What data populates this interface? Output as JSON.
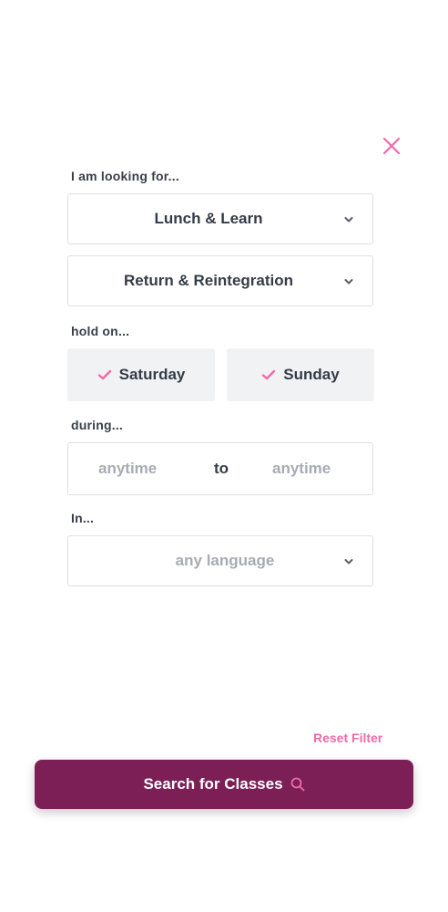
{
  "icons": {
    "close": "close-icon",
    "chevron": "chevron-down-icon",
    "check": "check-icon",
    "search": "search-icon"
  },
  "colors": {
    "accent_pink": "#f06aa8",
    "button_bg": "#7b1f56",
    "text_dark": "#353b47",
    "placeholder": "#a7abb3",
    "day_bg": "#f1f2f4"
  },
  "filter": {
    "looking_for_label": "I am looking for...",
    "class_type": {
      "selected": "Lunch & Learn"
    },
    "topic": {
      "selected": "Return & Reintegration"
    },
    "days_label": "hold on...",
    "days": [
      {
        "label": "Saturday",
        "checked": true
      },
      {
        "label": "Sunday",
        "checked": true
      }
    ],
    "time_label": "during...",
    "time": {
      "from": "anytime",
      "separator": "to",
      "to": "anytime"
    },
    "language_label": "In...",
    "language": {
      "placeholder": "any language"
    }
  },
  "actions": {
    "reset_label": "Reset Filter",
    "search_label": "Search for Classes"
  }
}
